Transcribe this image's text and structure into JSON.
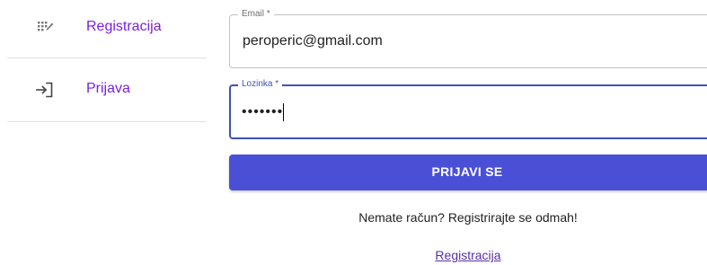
{
  "sidebar": {
    "items": [
      {
        "label": "Registracija",
        "icon": "registration-grid-icon"
      },
      {
        "label": "Prijava",
        "icon": "login-icon"
      }
    ],
    "accent_color": "#7b1fe0"
  },
  "form": {
    "email": {
      "label": "Email *",
      "value": "peroperic@gmail.com"
    },
    "password": {
      "label": "Lozinka *",
      "value": "•••••••"
    },
    "submit_label": "PRIJAVI SE",
    "submit_color": "#4a50d6",
    "focus_color": "#3f51b5"
  },
  "footer": {
    "prompt": "Nemate račun? Registrirajte se odmah!",
    "register_link": "Registracija"
  }
}
